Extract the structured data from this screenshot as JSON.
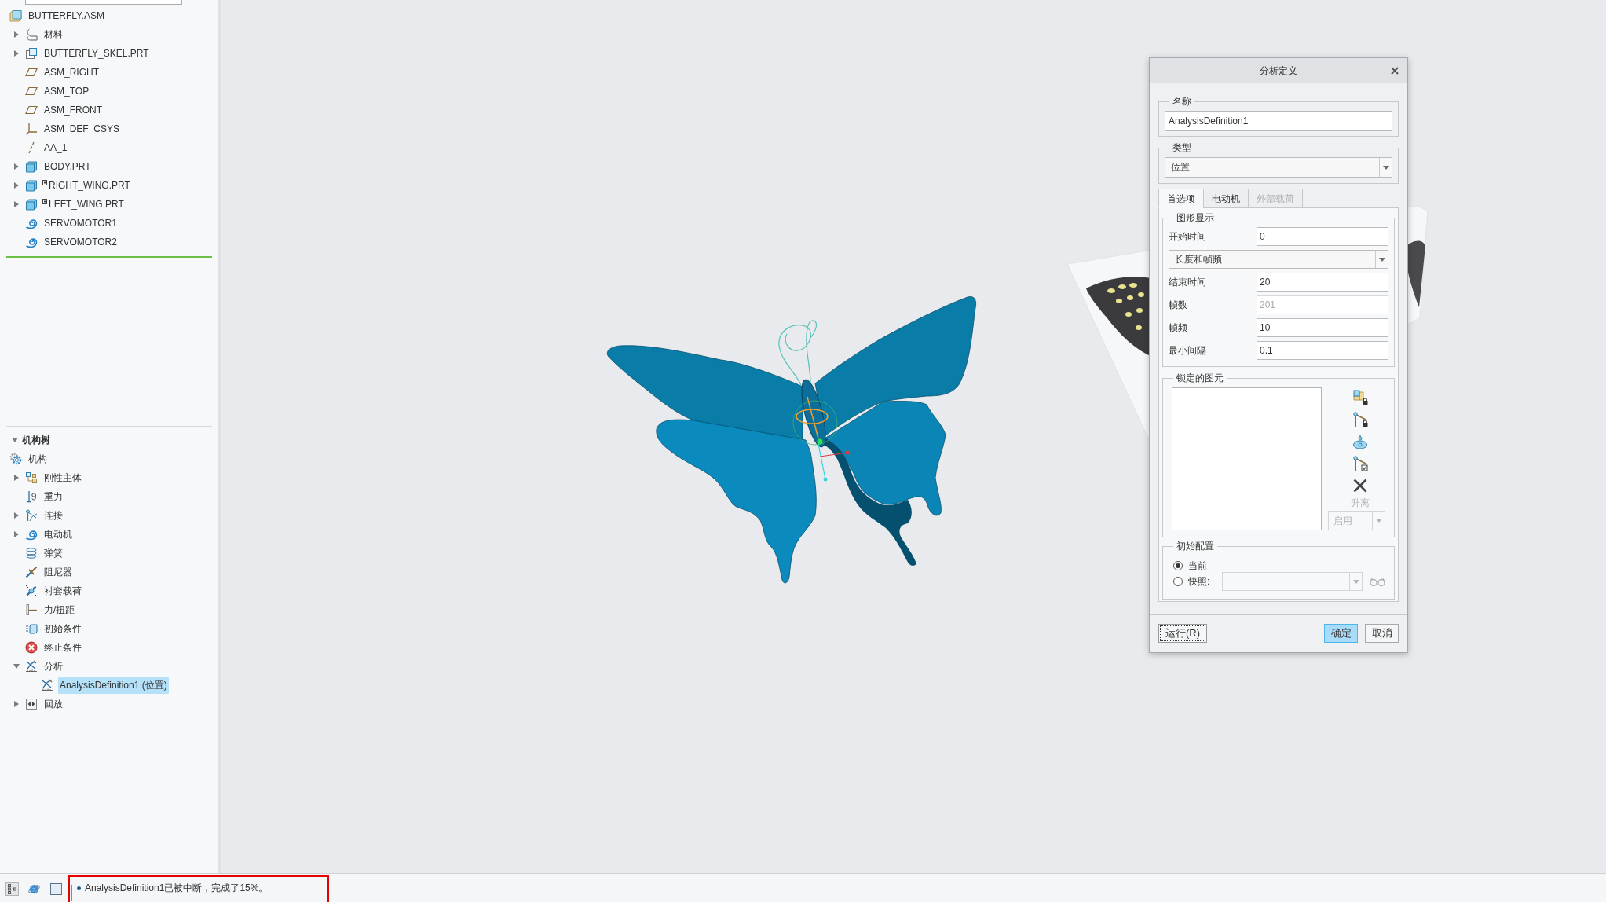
{
  "model_tree": {
    "items": [
      {
        "label": "BUTTERFLY.ASM",
        "kind": "assembly",
        "selected": false,
        "children": [
          {
            "label": "材料",
            "kind": "material",
            "expanded": false,
            "selected": false
          },
          {
            "label": "BUTTERFLY_SKEL.PRT",
            "kind": "skeleton",
            "expanded": false,
            "selected": false
          },
          {
            "label": "ASM_RIGHT",
            "kind": "plane",
            "selected": false
          },
          {
            "label": "ASM_TOP",
            "kind": "plane",
            "selected": false
          },
          {
            "label": "ASM_FRONT",
            "kind": "plane",
            "selected": false
          },
          {
            "label": "ASM_DEF_CSYS",
            "kind": "csys",
            "selected": false
          },
          {
            "label": "AA_1",
            "kind": "axis",
            "selected": false
          },
          {
            "label": "BODY.PRT",
            "kind": "part",
            "expanded": false,
            "flagged": false,
            "selected": false
          },
          {
            "label": "RIGHT_WING.PRT",
            "kind": "part",
            "expanded": false,
            "flagged": true,
            "selected": false
          },
          {
            "label": "LEFT_WING.PRT",
            "kind": "part",
            "expanded": false,
            "flagged": true,
            "selected": false
          },
          {
            "label": "SERVOMOTOR1",
            "kind": "servomotor",
            "selected": false
          },
          {
            "label": "SERVOMOTOR2",
            "kind": "servomotor",
            "selected": false
          }
        ]
      }
    ]
  },
  "mechanism_tree": {
    "title": "机构树",
    "expanded": true,
    "items": [
      {
        "label": "机构",
        "kind": "mechanism",
        "selected": false,
        "children": [
          {
            "label": "刚性主体",
            "kind": "bodies",
            "expanded": false,
            "selected": false
          },
          {
            "label": "重力",
            "kind": "gravity",
            "selected": false
          },
          {
            "label": "连接",
            "kind": "connections",
            "expanded": false,
            "selected": false
          },
          {
            "label": "电动机",
            "kind": "motors",
            "expanded": false,
            "selected": false
          },
          {
            "label": "弹簧",
            "kind": "springs",
            "selected": false
          },
          {
            "label": "阻尼器",
            "kind": "dampers",
            "selected": false
          },
          {
            "label": "衬套载荷",
            "kind": "bushings",
            "selected": false
          },
          {
            "label": "力/扭距",
            "kind": "forces",
            "selected": false
          },
          {
            "label": "初始条件",
            "kind": "initial",
            "selected": false
          },
          {
            "label": "终止条件",
            "kind": "termination",
            "selected": false
          },
          {
            "label": "分析",
            "kind": "analyses",
            "expanded": true,
            "selected": false,
            "children": [
              {
                "label": "AnalysisDefinition1 (位置)",
                "kind": "analysis",
                "selected": true
              }
            ]
          },
          {
            "label": "回放",
            "kind": "playbacks",
            "expanded": false,
            "selected": false
          }
        ]
      }
    ]
  },
  "dialog": {
    "title": "分析定义",
    "name_group": {
      "label": "名称",
      "value": "AnalysisDefinition1"
    },
    "type_group": {
      "label": "类型",
      "value": "位置"
    },
    "tabs": [
      {
        "label": "首选项",
        "selected": true,
        "disabled": false
      },
      {
        "label": "电动机",
        "selected": false,
        "disabled": false
      },
      {
        "label": "外部载荷",
        "selected": false,
        "disabled": true
      }
    ],
    "graphics_group": {
      "label": "图形显示",
      "rows": [
        {
          "kind": "field",
          "label": "开始时间",
          "value": "0",
          "disabled": false
        },
        {
          "kind": "select",
          "value": "长度和帧频"
        },
        {
          "kind": "field",
          "label": "结束时间",
          "value": "20",
          "disabled": false
        },
        {
          "kind": "field",
          "label": "帧数",
          "value": "201",
          "disabled": true
        },
        {
          "kind": "field",
          "label": "帧频",
          "value": "10",
          "disabled": false
        },
        {
          "kind": "field",
          "label": "最小间隔",
          "value": "0.1",
          "disabled": false
        }
      ]
    },
    "locked_group": {
      "label": "锁定的图元",
      "tool_caption": {
        "text": "升离",
        "disabled": true
      },
      "mode_select": {
        "value": "启用",
        "disabled": true
      }
    },
    "initial_group": {
      "label": "初始配置",
      "options": [
        {
          "label": "当前",
          "selected": true
        },
        {
          "label": "快照:",
          "selected": false
        }
      ],
      "snapshot_select": {
        "disabled": true
      }
    },
    "footer": {
      "left": [
        {
          "label": "运行(R)",
          "kind": "focused"
        }
      ],
      "right": [
        {
          "label": "确定",
          "kind": "primary"
        },
        {
          "label": "取消",
          "kind": "plain"
        }
      ]
    }
  },
  "status_bar": {
    "tools": [
      {
        "kind": "tree",
        "on": true
      },
      {
        "kind": "globe",
        "on": false
      },
      {
        "kind": "window",
        "on": false
      }
    ],
    "highlighted": true,
    "message": "AnalysisDefinition1已被中断，完成了15%。"
  }
}
